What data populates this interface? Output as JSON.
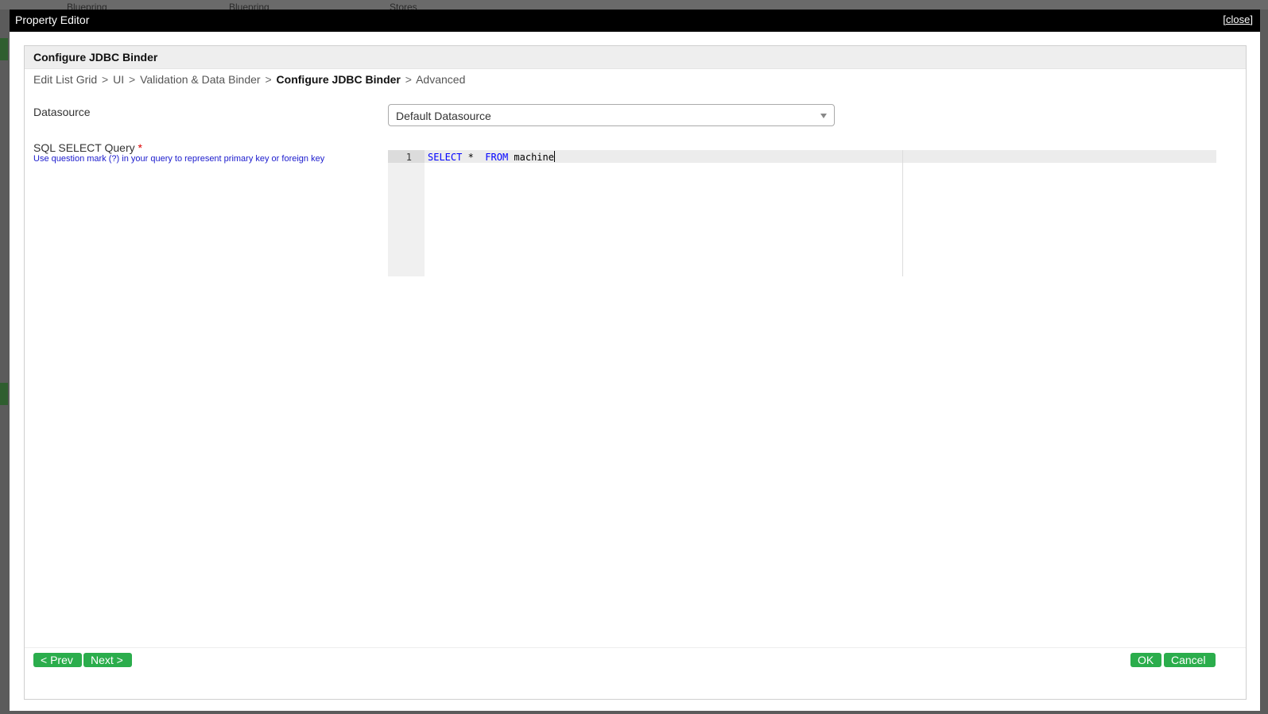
{
  "background": {
    "tabs": [
      "Bluepring",
      "Bluepring",
      "Stores"
    ]
  },
  "modal": {
    "title": "Property Editor",
    "close_label": "[close]"
  },
  "panel": {
    "title": "Configure JDBC Binder"
  },
  "breadcrumb": {
    "items": [
      "Edit List Grid",
      "UI",
      "Validation & Data Binder",
      "Configure JDBC Binder",
      "Advanced"
    ],
    "separator": ">",
    "current_index": 3
  },
  "form": {
    "datasource": {
      "label": "Datasource",
      "value": "Default Datasource"
    },
    "query": {
      "label": "SQL SELECT Query",
      "required_marker": "*",
      "hint": "Use question mark (?) in your query to represent primary key or foreign key",
      "line_number": "1",
      "code": {
        "kw1": "SELECT",
        "star": " *  ",
        "kw2": "FROM",
        "rest": " machine"
      }
    }
  },
  "buttons": {
    "prev": "< Prev",
    "next": "Next >",
    "ok": "OK",
    "cancel": "Cancel"
  },
  "colors": {
    "button_green": "#2bad4c",
    "hint_blue": "#1a1acd",
    "required_red": "#dd0000",
    "keyword_blue": "#0000ff"
  }
}
